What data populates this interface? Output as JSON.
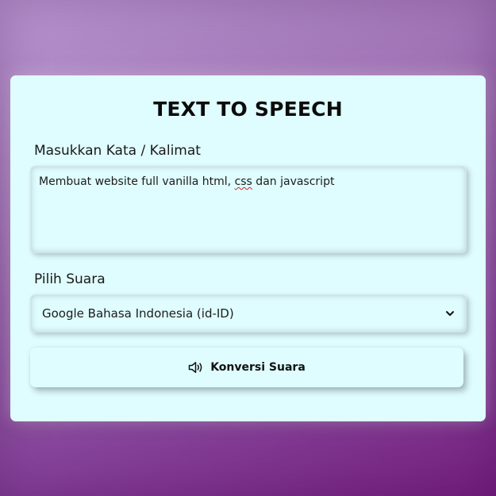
{
  "app": {
    "title": "TEXT TO SPEECH"
  },
  "form": {
    "text_label": "Masukkan Kata / Kalimat",
    "text_value_before": "Membuat website full vanilla html, ",
    "text_value_spell": "css",
    "text_value_after": " dan javascript",
    "voice_label": "Pilih Suara",
    "voice_selected": "Google Bahasa Indonesia (id-ID)",
    "convert_button": "Konversi Suara"
  },
  "icons": {
    "voice_select": "chevron-down-icon",
    "convert_button": "speaker-icon"
  },
  "colors": {
    "card_background": "#dffcfe",
    "spellcheck_underline": "#e02020"
  }
}
